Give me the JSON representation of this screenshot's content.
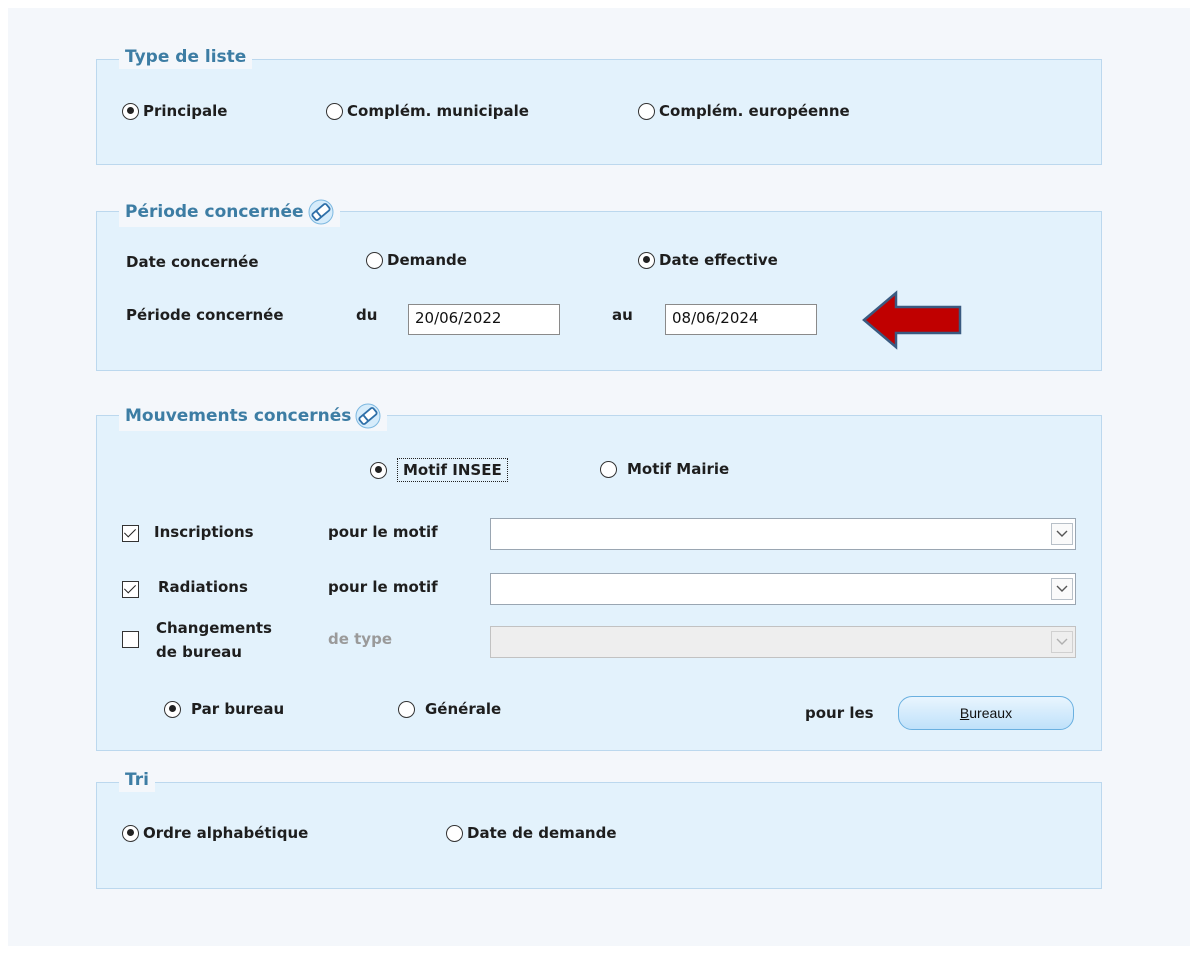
{
  "type_liste": {
    "legend": "Type de liste",
    "options": [
      "Principale",
      "Complém. municipale",
      "Complém. européenne"
    ],
    "selected": "Principale"
  },
  "periode": {
    "legend": "Période concernée",
    "date_label": "Date concernée",
    "date_options": [
      "Demande",
      "Date effective"
    ],
    "date_selected": "Date effective",
    "periode_label": "Période concernée",
    "du_label": "du",
    "du_value": "20/06/2022",
    "au_label": "au",
    "au_value": "08/06/2024"
  },
  "mouvements": {
    "legend": "Mouvements concernés",
    "motif_options": [
      "Motif INSEE",
      "Motif Mairie"
    ],
    "motif_selected": "Motif INSEE",
    "inscriptions_label": "Inscriptions",
    "inscriptions_checked": true,
    "inscriptions_motif_label": "pour le motif",
    "inscriptions_motif_value": "",
    "radiations_label": "Radiations",
    "radiations_checked": true,
    "radiations_motif_label": "pour le motif",
    "radiations_motif_value": "",
    "changements_label_line1": "Changements",
    "changements_label_line2": "de bureau",
    "changements_checked": false,
    "changements_type_label": "de type",
    "changements_type_value": "",
    "scope_options": [
      "Par bureau",
      "Générale"
    ],
    "scope_selected": "Par bureau",
    "pour_les_label": "pour les",
    "bureaux_button_underlined": "B",
    "bureaux_button_rest": "ureaux"
  },
  "tri": {
    "legend": "Tri",
    "options": [
      "Ordre alphabétique",
      "Date de demande"
    ],
    "selected": "Ordre alphabétique"
  },
  "colors": {
    "legend_text": "#3d7da4",
    "group_bg": "#e3f2fc",
    "group_border": "#bcd8ee",
    "arrow_fill": "#c00000",
    "arrow_stroke": "#3a5a80",
    "button_border": "#6ab0e0"
  },
  "icons": {
    "eraser": "eraser-icon",
    "annotation_arrow": "arrow-left-icon"
  }
}
